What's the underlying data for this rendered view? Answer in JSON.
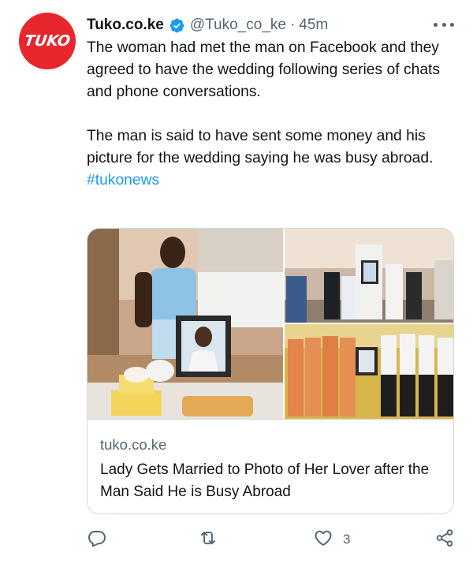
{
  "tweet": {
    "avatar_text": "TUKO",
    "display_name": "Tuko.co.ke",
    "handle": "@Tuko_co_ke",
    "separator": "·",
    "time": "45m",
    "paragraphs": [
      "The woman had met the man on Facebook and they agreed to have the wedding following series of chats and phone conversations.",
      "The man is said to have sent some money and his picture for the wedding saying he was busy abroad."
    ],
    "hashtag": "#tukonews"
  },
  "card": {
    "domain": "tuko.co.ke",
    "title": "Lady Gets Married to Photo of Her Lover after the Man Said He is Busy Abroad"
  },
  "actions": {
    "reply_icon": "reply-icon",
    "retweet_icon": "retweet-icon",
    "like_icon": "heart-icon",
    "like_count": "3",
    "share_icon": "share-icon"
  },
  "colors": {
    "brand": "#e8262d",
    "link": "#1d9bf0",
    "muted": "#536471",
    "text": "#0f1419",
    "border": "#cfd9de"
  }
}
